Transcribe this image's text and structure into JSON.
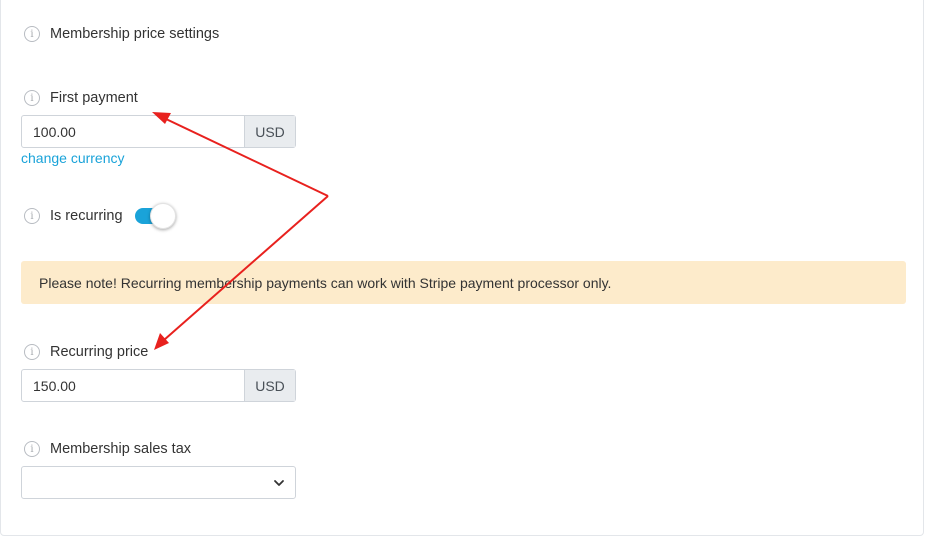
{
  "settings_title": "Membership price settings",
  "first_payment": {
    "label": "First payment",
    "value": "100.00",
    "currency": "USD",
    "change_currency_link": "change currency"
  },
  "is_recurring": {
    "label": "Is recurring",
    "enabled": true
  },
  "note": "Please note! Recurring membership payments can work with Stripe payment processor only.",
  "recurring_price": {
    "label": "Recurring price",
    "value": "150.00",
    "currency": "USD"
  },
  "sales_tax": {
    "label": "Membership sales tax",
    "selected": ""
  },
  "icons": {
    "info": "info-circle-icon",
    "dropdown": "chevron-down-icon"
  },
  "colors": {
    "accent": "#1aa3d9",
    "note_background": "#fdebcb",
    "annotation_arrow": "#e8211e",
    "addon_background": "#e9ecef"
  }
}
